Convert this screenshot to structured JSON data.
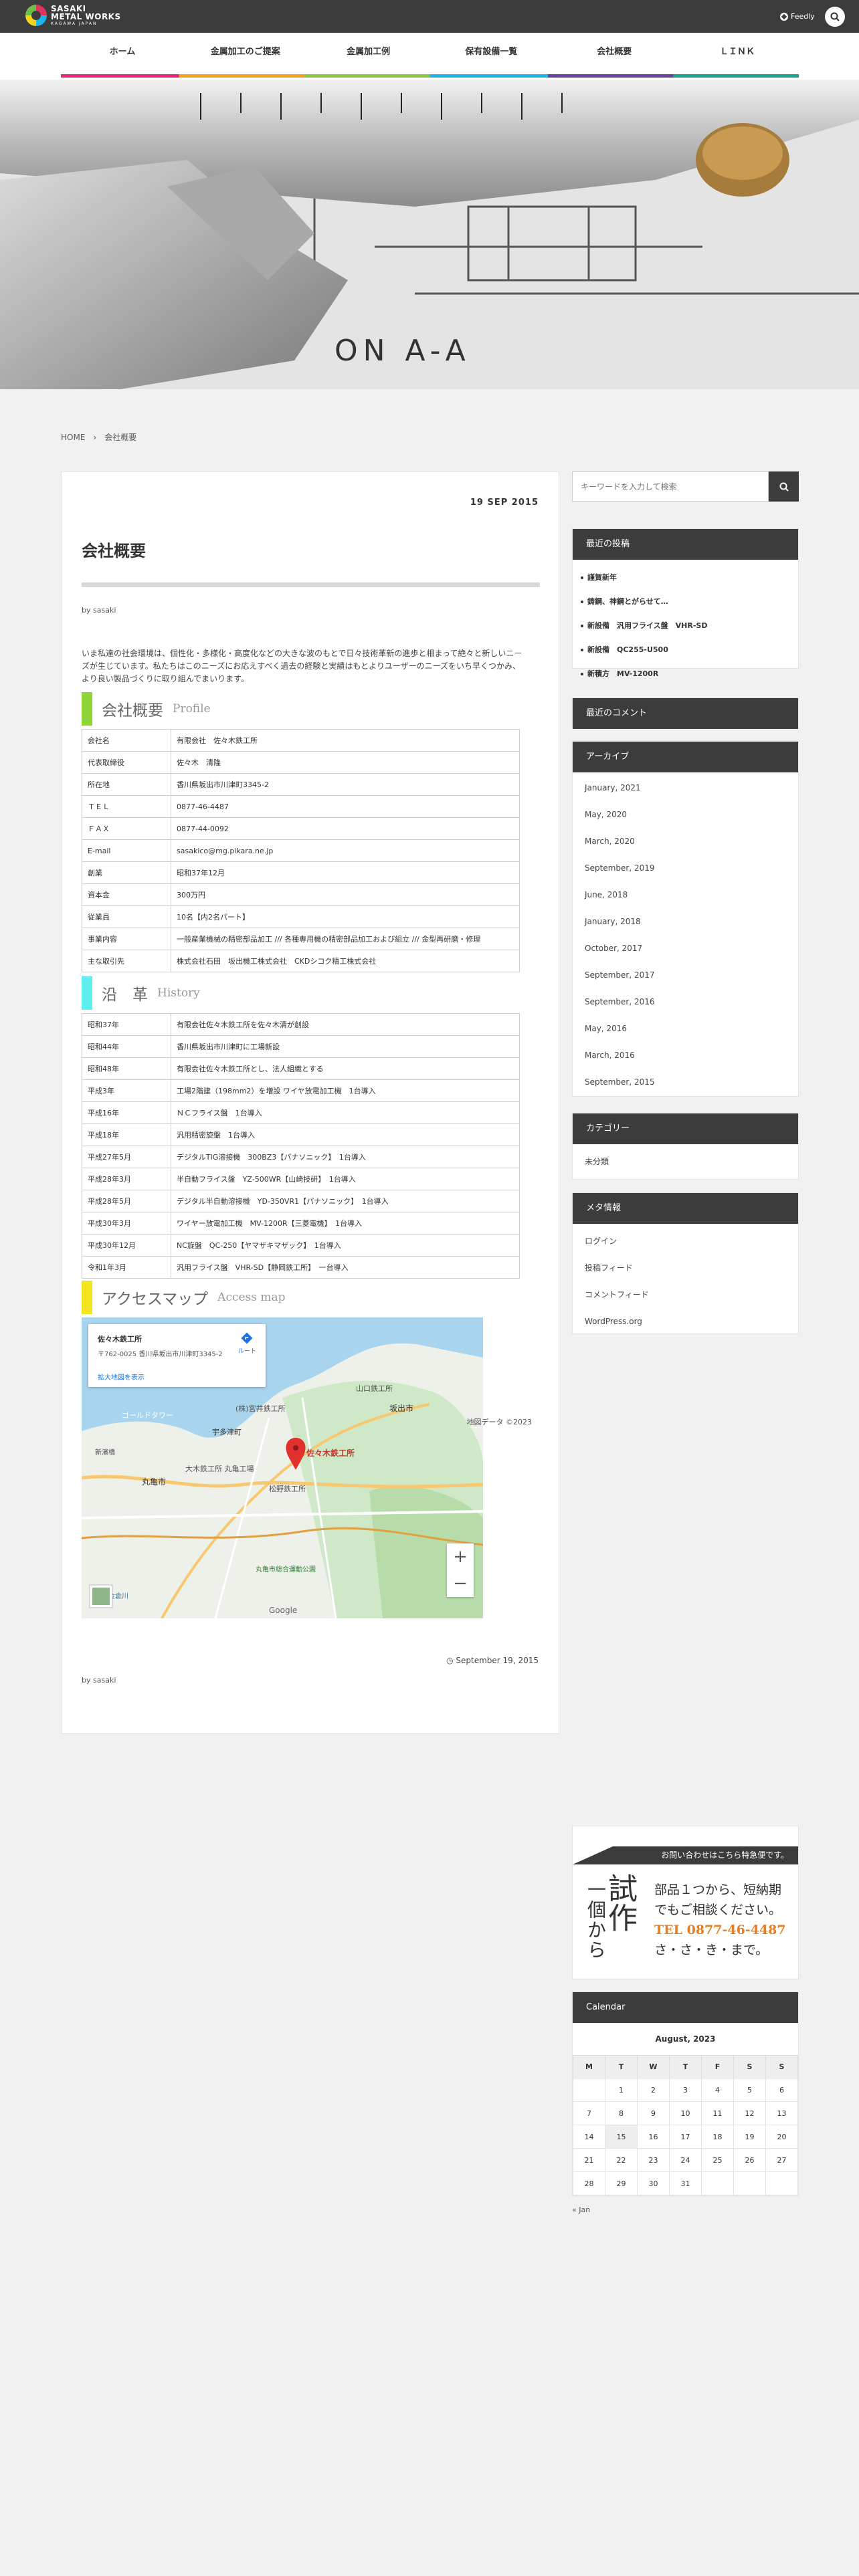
{
  "site": {
    "logo_line1": "SASAKI",
    "logo_line2": "METAL WORKS",
    "logo_tagline": "KAGAWA JAPAN",
    "feedly_label": "Feedly"
  },
  "nav": {
    "items": [
      "ホーム",
      "金属加工のご提案",
      "金属加工例",
      "保有設備一覧",
      "会社概要",
      "ＬＩＮＫ"
    ]
  },
  "breadcrumb": {
    "home": "HOME",
    "current": "会社概要"
  },
  "post": {
    "date": "19 SEP 2015",
    "title": "会社概要",
    "byline_prefix": "by",
    "author": "sasaki",
    "intro": "いま私達の社会環境は、個性化・多様化・高度化などの大きな波のもとで日々技術革新の進歩と相まって絶々と新しいニーズが生じています。私たちはこのニーズにお応えすべく過去の経験と実績はもとよりユーザーのニーズをいち早くつかみ、より良い製品づくりに取り組んでまいります。",
    "footer_date": "September 19, 2015"
  },
  "profile": {
    "heading_jp": "会社概要",
    "heading_en": "Profile",
    "accent": "#8ed43a",
    "rows": [
      [
        "会社名",
        "有限会社　佐々木鉄工所"
      ],
      [
        "代表取締役",
        "佐々木　清隆"
      ],
      [
        "所在地",
        "香川県坂出市川津町3345-2"
      ],
      [
        "ＴＥＬ",
        "0877-46-4487"
      ],
      [
        "ＦＡＸ",
        "0877-44-0092"
      ],
      [
        "E-mail",
        "sasakico@mg.pikara.ne.jp"
      ],
      [
        "創業",
        "昭和37年12月"
      ],
      [
        "資本金",
        "300万円"
      ],
      [
        "従業員",
        "10名【内2名パート】"
      ],
      [
        "事業内容",
        "一般産業機械の精密部品加工 /// 各種専用機の精密部品加工および組立 /// 金型再研磨・修理"
      ],
      [
        "主な取引先",
        "株式会社石田　坂出機工株式会社　CKDシコク精工株式会社"
      ]
    ]
  },
  "history": {
    "heading_jp": "沿　革",
    "heading_en": "History",
    "accent": "#5ef0ef",
    "rows": [
      [
        "昭和37年",
        "有限会社佐々木鉄工所を佐々木清が創設"
      ],
      [
        "昭和44年",
        "香川県坂出市川津町に工場新設"
      ],
      [
        "昭和48年",
        "有限会社佐々木鉄工所とし、法人組織とする"
      ],
      [
        "平成3年",
        "工場2階建（198mm2）を増設 ワイヤ放電加工機　1台導入"
      ],
      [
        "平成16年",
        "ＮＣフライス盤　1台導入"
      ],
      [
        "平成18年",
        "汎用精密旋盤　1台導入"
      ],
      [
        "平成27年5月",
        "デジタルTIG溶接機　300BZ3【パナソニック】　1台導入"
      ],
      [
        "平成28年3月",
        "半自動フライス盤　YZ-500WR【山崎技研】　1台導入"
      ],
      [
        "平成28年5月",
        "デジタル半自動溶接機　YD-350VR1【パナソニック】　1台導入"
      ],
      [
        "平成30年3月",
        "ワイヤー放電加工機　MV-1200R【三菱電機】　1台導入"
      ],
      [
        "平成30年12月",
        "NC旋盤　QC-250【ヤマザキマザック】　1台導入"
      ],
      [
        "令和1年3月",
        "汎用フライス盤　VHR-SD【静岡鉄工所】　一台導入"
      ]
    ]
  },
  "access": {
    "heading_jp": "アクセスマップ",
    "heading_en": "Access map",
    "accent": "#f2e41e",
    "popup_title": "佐々木鉄工所",
    "popup_address": "〒762-0025 香川県坂出市川津町3345-2",
    "popup_link": "拡大地図を表示",
    "route_label": "ルート",
    "marker_label": "佐々木鉄工所",
    "places": [
      "山口鉄工所",
      "坂出市",
      "(株)宮井鉄工所",
      "宇多津町",
      "ゴールドタワー",
      "丸亀市",
      "新濱橋",
      "大木鉄工所 丸亀工場",
      "松野鉄工所",
      "丸亀市総合運動公園",
      "金倉川"
    ],
    "zoom_in": "+",
    "zoom_out": "−",
    "map_footer": "地図データ ©2023",
    "google": "Google"
  },
  "sidebar": {
    "search_placeholder": "キーワードを入力して検索",
    "recent_title": "最近の投稿",
    "recent_posts": [
      "謹賀新年",
      "鋳鋼、神鋼とがらせて…",
      "新設備　汎用フライス盤　VHR-SD",
      "新設備　QC255-U500",
      "新積方　MV-1200R"
    ],
    "comments_title": "最近のコメント",
    "archive_title": "アーカイブ",
    "archives": [
      "January, 2021",
      "May, 2020",
      "March, 2020",
      "September, 2019",
      "June, 2018",
      "January, 2018",
      "October, 2017",
      "September, 2017",
      "September, 2016",
      "May, 2016",
      "March, 2016",
      "September, 2015"
    ],
    "category_title": "カテゴリー",
    "categories": [
      "未分類"
    ],
    "meta_title": "メタ情報",
    "meta_links": [
      "ログイン",
      "投稿フィード",
      "コメントフィード",
      "WordPress.org"
    ],
    "banner": {
      "top": "お問い合わせはこちら特急便です。",
      "v1": "一個から",
      "v2": "試作",
      "line1": "部品１つから、短納期",
      "line2": "でもご相談ください。",
      "tel": "TEL 0877-46-4487",
      "line3": "さ・さ・き・まで。"
    },
    "calendar_title": "Calendar",
    "calendar_month": "August, 2023",
    "calendar_days": [
      "M",
      "T",
      "W",
      "T",
      "F",
      "S",
      "S"
    ],
    "calendar_weeks": [
      [
        "",
        "1",
        "2",
        "3",
        "4",
        "5",
        "6"
      ],
      [
        "7",
        "8",
        "9",
        "10",
        "11",
        "12",
        "13"
      ],
      [
        "14",
        "15",
        "16",
        "17",
        "18",
        "19",
        "20"
      ],
      [
        "21",
        "22",
        "23",
        "24",
        "25",
        "26",
        "27"
      ],
      [
        "28",
        "29",
        "30",
        "31",
        "",
        "",
        ""
      ]
    ],
    "calendar_today": "15",
    "calendar_prev": "« Jan"
  }
}
